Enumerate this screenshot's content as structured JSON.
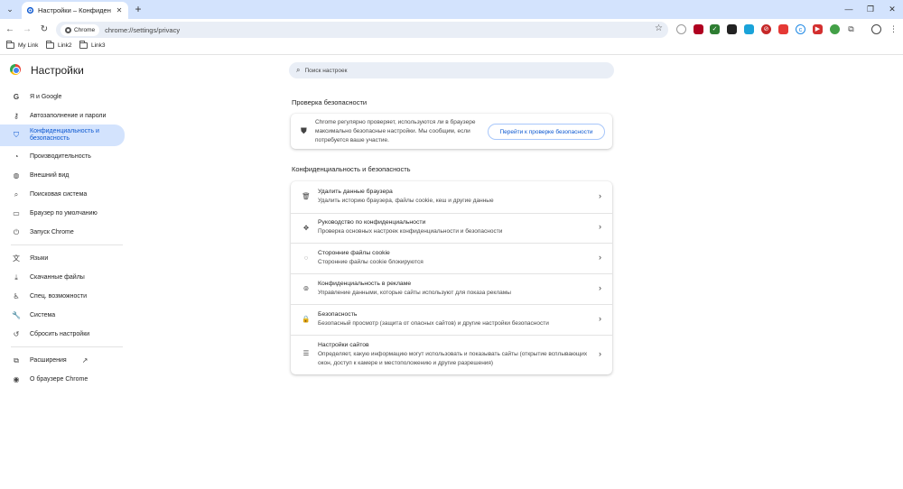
{
  "browser": {
    "tab_title": "Настройки – Конфиденциальн...",
    "close_tab": "✕",
    "new_tab": "+",
    "omnibox_chip": "Chrome",
    "url": "chrome://settings/privacy",
    "bookmarks": [
      "My Link",
      "Link2",
      "Link3"
    ]
  },
  "settings": {
    "title": "Настройки",
    "search_placeholder": "Поиск настроек"
  },
  "sidebar": {
    "items": [
      {
        "label": "Я и Google",
        "icon": "google-icon"
      },
      {
        "label": "Автозаполнение и пароли",
        "icon": "key-icon"
      },
      {
        "label": "Конфиденциальность и безопасность",
        "icon": "shield-icon",
        "active": true
      },
      {
        "label": "Производительность",
        "icon": "speedometer-icon"
      },
      {
        "label": "Внешний вид",
        "icon": "palette-icon"
      },
      {
        "label": "Поисковая система",
        "icon": "search-icon"
      },
      {
        "label": "Браузер по умолчанию",
        "icon": "browser-window-icon"
      },
      {
        "label": "Запуск Chrome",
        "icon": "power-icon"
      },
      {
        "label": "Языки",
        "icon": "translate-icon"
      },
      {
        "label": "Скачанные файлы",
        "icon": "download-icon"
      },
      {
        "label": "Спец. возможности",
        "icon": "accessibility-icon"
      },
      {
        "label": "Система",
        "icon": "wrench-icon"
      },
      {
        "label": "Сбросить настройки",
        "icon": "reset-icon"
      },
      {
        "label": "Расширения",
        "icon": "puzzle-icon"
      },
      {
        "label": "О браузере Chrome",
        "icon": "chrome-icon"
      }
    ]
  },
  "safety_check": {
    "title": "Проверка безопасности",
    "text": "Chrome регулярно проверяет, используются ли в браузере максимально безопасные настройки. Мы сообщим, если потребуется ваше участие.",
    "button": "Перейти к проверке безопасности"
  },
  "privacy": {
    "title": "Конфиденциальность и безопасность",
    "rows": [
      {
        "title": "Удалить данные браузера",
        "desc": "Удалить историю браузера, файлы cookie, кеш и другие данные",
        "icon": "trash-icon"
      },
      {
        "title": "Руководство по конфиденциальности",
        "desc": "Проверка основных настроек конфиденциальности и безопасности",
        "icon": "guide-icon"
      },
      {
        "title": "Сторонние файлы cookie",
        "desc": "Сторонние файлы cookie блокируются",
        "icon": "cookie-icon"
      },
      {
        "title": "Конфиденциальность в рекламе",
        "desc": "Управление данными, которые сайты используют для показа рекламы",
        "icon": "ad-privacy-icon"
      },
      {
        "title": "Безопасность",
        "desc": "Безопасный просмотр (защита от опасных сайтов) и другие настройки безопасности",
        "icon": "lock-icon"
      },
      {
        "title": "Настройки сайтов",
        "desc": "Определяет, какую информацию могут использовать и показывать сайты (открытие всплывающих окон, доступ к камере и местоположению и другие разрешения)",
        "icon": "sliders-icon"
      }
    ]
  },
  "colors": {
    "accent": "#0b57d0",
    "active_bg": "#d3e3fd",
    "tabstrip": "#d3e3fd",
    "omnibox": "#e9eef6"
  }
}
